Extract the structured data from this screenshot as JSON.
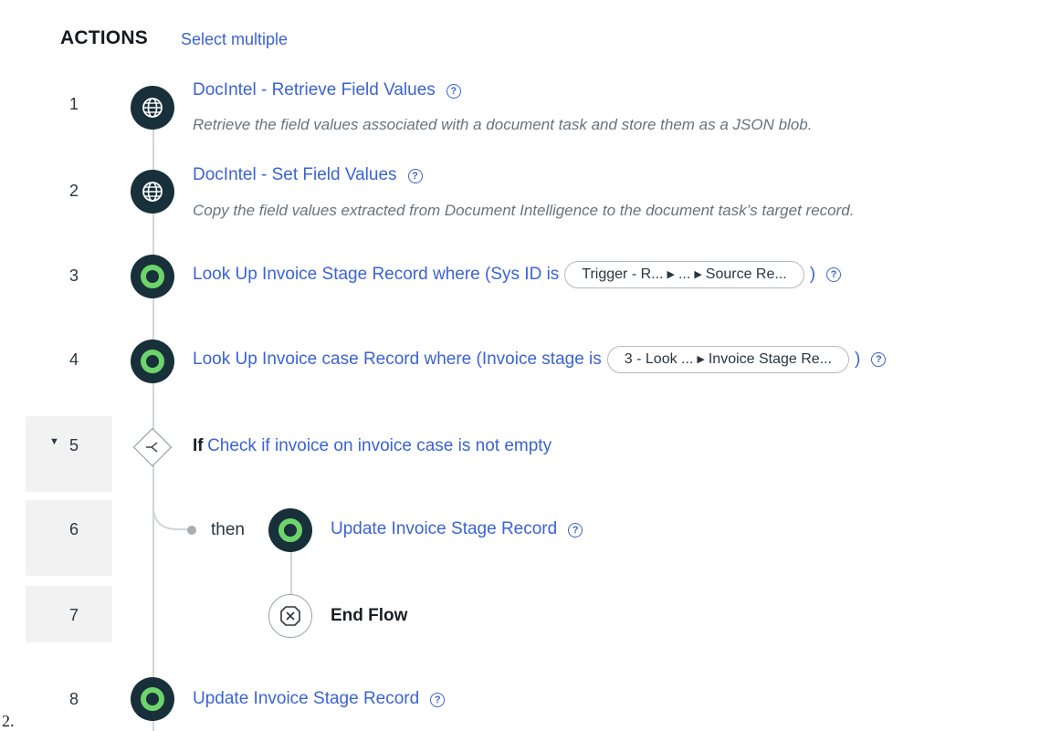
{
  "header": {
    "title": "ACTIONS",
    "select_multiple": "Select multiple"
  },
  "rows": [
    {
      "num": "1",
      "title": "DocIntel - Retrieve Field Values",
      "desc": "Retrieve the field values associated with a document task and store them as a JSON blob.",
      "icon": "globe-icon"
    },
    {
      "num": "2",
      "title": "DocIntel - Set Field Values",
      "desc": "Copy the field values extracted from Document Intelligence to the document task’s target record.",
      "icon": "globe-icon"
    },
    {
      "num": "3",
      "title": "Look Up Invoice Stage Record where (Sys ID is",
      "pill_parts": [
        "Trigger - R...",
        "...",
        "Source Re..."
      ],
      "close": ")",
      "icon": "record-icon"
    },
    {
      "num": "4",
      "title": "Look Up Invoice case Record where (Invoice stage is",
      "pill_parts": [
        "3 - Look ...",
        "Invoice Stage Re..."
      ],
      "close": ")",
      "icon": "record-icon"
    },
    {
      "num": "5",
      "if_label": "If",
      "if_text": "Check if invoice on invoice case is not empty",
      "icon": "branch-icon",
      "expanded": true
    },
    {
      "num": "6",
      "then_label": "then",
      "title": "Update Invoice Stage Record",
      "icon": "record-icon"
    },
    {
      "num": "7",
      "title": "End Flow",
      "icon": "end-flow-icon"
    },
    {
      "num": "8",
      "title": "Update Invoice Stage Record",
      "icon": "record-icon"
    }
  ],
  "help_glyph": "?",
  "page_marker": "2.",
  "colors": {
    "link": "#3a63d6",
    "icon_dark": "#17303a",
    "icon_green": "#6ed36a",
    "row_highlight": "#f2f2f2"
  }
}
